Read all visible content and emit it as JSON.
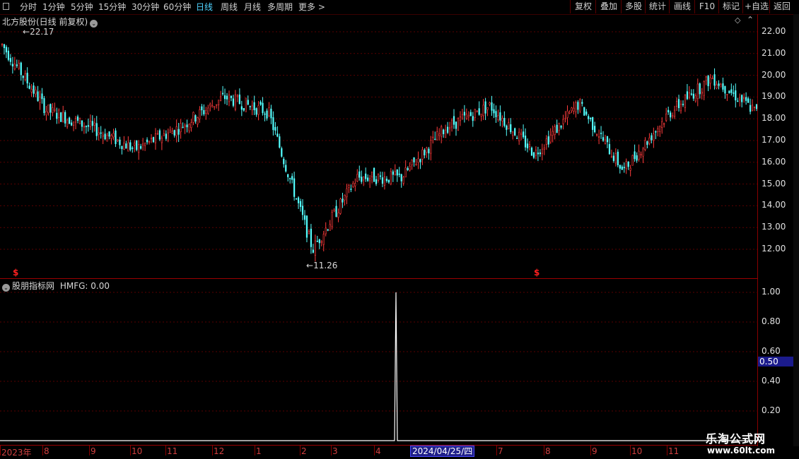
{
  "toolbar": {
    "periods": [
      "分时",
      "1分钟",
      "5分钟",
      "15分钟",
      "30分钟",
      "60分钟",
      "日线",
      "周线",
      "月线",
      "多周期",
      "更多 >"
    ],
    "active_period": "日线",
    "right_buttons": [
      "复权",
      "叠加",
      "多股",
      "统计",
      "画线",
      "F10",
      "标记",
      "+自选",
      "返回"
    ]
  },
  "main_panel": {
    "title": "北方股份(日线 前复权)",
    "y_ticks": [
      "22.00",
      "21.00",
      "20.00",
      "19.00",
      "18.00",
      "17.00",
      "16.00",
      "15.00",
      "14.00",
      "13.00",
      "12.00"
    ],
    "high_label": "22.17",
    "low_label": "11.26",
    "signal_marker": "$"
  },
  "indicator_panel": {
    "title": "股朋指标网",
    "value_label": "HMFG: 0.00",
    "y_ticks": [
      "1.00",
      "0.80",
      "0.60",
      "0.40",
      "0.20"
    ],
    "current_value_tag": "0.50"
  },
  "x_axis": {
    "labels": [
      "2023年",
      "8",
      "9",
      "10",
      "11",
      "12",
      "1",
      "2",
      "3",
      "4",
      "2024/04/25/四",
      "7",
      "8",
      "9",
      "10",
      "11"
    ],
    "highlighted_date": "2024/04/25/四"
  },
  "watermark": {
    "name": "乐淘公式网",
    "url": "www.60lt.com"
  },
  "colors": {
    "up": "#ff3c3c",
    "down": "#54ffff",
    "grid": "#5a0000",
    "indicator_line": "#ffffff",
    "active_tab": "#4fd3ff"
  },
  "chart_data": {
    "type": "candlestick",
    "ylim": [
      11,
      22.5
    ],
    "approx_close_path": [
      {
        "month": "2023-07",
        "close": 21.4
      },
      {
        "month": "2023-08",
        "close": 18.4
      },
      {
        "month": "2023-09",
        "close": 17.6
      },
      {
        "month": "2023-10",
        "close": 16.6
      },
      {
        "month": "2023-11",
        "close": 17.6
      },
      {
        "month": "2023-12",
        "close": 19.0
      },
      {
        "month": "2024-01",
        "close": 18.3
      },
      {
        "month": "2024-02",
        "close": 12.0
      },
      {
        "month": "2024-03",
        "close": 15.3
      },
      {
        "month": "2024-04",
        "close": 15.3
      },
      {
        "month": "2024-05",
        "close": 17.6
      },
      {
        "month": "2024-06",
        "close": 18.6
      },
      {
        "month": "2024-07",
        "close": 16.4
      },
      {
        "month": "2024-08",
        "close": 18.7
      },
      {
        "month": "2024-09",
        "close": 15.6
      },
      {
        "month": "2024-10",
        "close": 18.2
      },
      {
        "month": "2024-11",
        "close": 19.9
      },
      {
        "month": "2024-12",
        "close": 18.3
      }
    ],
    "indicator": {
      "name": "HMFG",
      "ylim": [
        0,
        1.05
      ],
      "signal_date": "2024/04/25",
      "signal_value": 1.0
    }
  }
}
